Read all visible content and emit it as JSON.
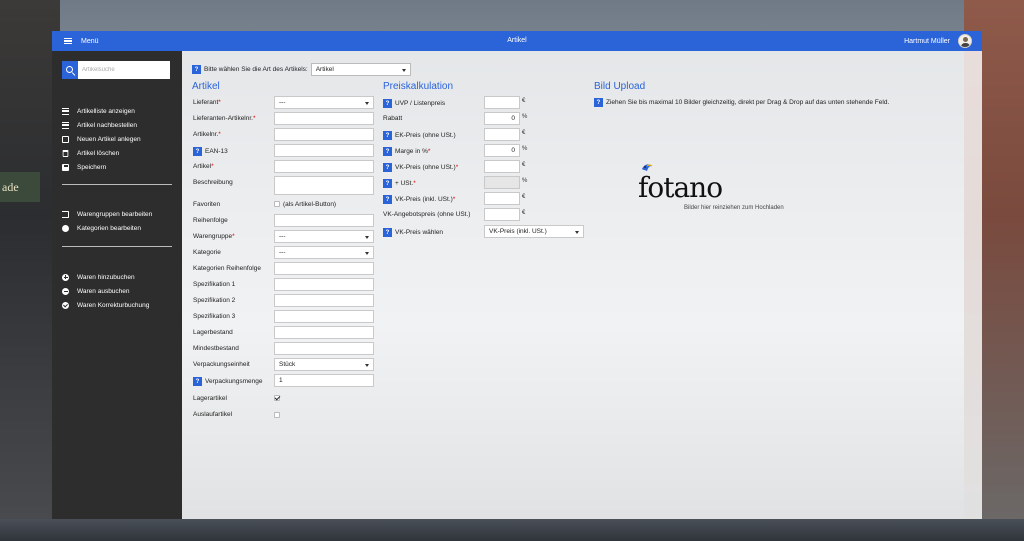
{
  "topbar": {
    "menu_label": "Menü",
    "title": "Artikel",
    "user_name": "Hartmut Müller"
  },
  "sidebar": {
    "search_placeholder": "Artikelsuche",
    "group1": [
      {
        "label": "Artikelliste anzeigen",
        "icon": "list-icon"
      },
      {
        "label": "Artikel nachbestellen",
        "icon": "list-icon"
      },
      {
        "label": "Neuen Artikel anlegen",
        "icon": "edit-icon"
      },
      {
        "label": "Artikel löschen",
        "icon": "trash-icon"
      },
      {
        "label": "Speichern",
        "icon": "save-icon"
      }
    ],
    "group2": [
      {
        "label": "Warengruppen bearbeiten",
        "icon": "sign-in-icon"
      },
      {
        "label": "Kategorien bearbeiten",
        "icon": "arrow-circle-icon"
      }
    ],
    "group3": [
      {
        "label": "Waren hinzubuchen",
        "icon": "plus-circle-icon"
      },
      {
        "label": "Waren ausbuchen",
        "icon": "minus-circle-icon"
      },
      {
        "label": "Waren Korrekturbuchung",
        "icon": "check-circle-icon"
      }
    ]
  },
  "article_type": {
    "label": "Bitte wählen Sie die Art des Artikels:",
    "value": "Artikel"
  },
  "artikel": {
    "title": "Artikel",
    "fields": {
      "lieferant": {
        "label": "Lieferant",
        "value": "---"
      },
      "lieferanten_nr": {
        "label": "Lieferanten-Artikelnr.",
        "value": ""
      },
      "artikelnr": {
        "label": "Artikelnr.",
        "value": ""
      },
      "ean": {
        "label": "EAN-13",
        "value": ""
      },
      "artikel": {
        "label": "Artikel",
        "value": ""
      },
      "beschreibung": {
        "label": "Beschreibung",
        "value": ""
      },
      "favoriten": {
        "label": "Favoriten",
        "checkbox_text": "(als Artikel-Button)"
      },
      "reihenfolge": {
        "label": "Reihenfolge",
        "value": ""
      },
      "warengruppe": {
        "label": "Warengruppe",
        "value": "---"
      },
      "kategorie": {
        "label": "Kategorie",
        "value": "---"
      },
      "kategorien_reihenfolge": {
        "label": "Kategorien Reihenfolge",
        "value": ""
      },
      "spez1": {
        "label": "Spezifikation 1",
        "value": ""
      },
      "spez2": {
        "label": "Spezifikation 2",
        "value": ""
      },
      "spez3": {
        "label": "Spezifikation 3",
        "value": ""
      },
      "lagerbestand": {
        "label": "Lagerbestand",
        "value": ""
      },
      "mindestbestand": {
        "label": "Mindestbestand",
        "value": ""
      },
      "verpackungseinheit": {
        "label": "Verpackungseinheit",
        "value": "Stück"
      },
      "verpackungsmenge": {
        "label": "Verpackungsmenge",
        "value": "1"
      },
      "lagerartikel": {
        "label": "Lagerartikel",
        "checked": true
      },
      "auslaufartikel": {
        "label": "Auslaufartikel",
        "checked": false
      }
    },
    "required_mark": "*"
  },
  "preis": {
    "title": "Preiskalkulation",
    "uvp": {
      "label": "UVP / Listenpreis",
      "value": "",
      "unit": "€"
    },
    "rabatt": {
      "label": "Rabatt",
      "value": "0",
      "unit": "%"
    },
    "ek": {
      "label": "EK-Preis (ohne USt.)",
      "value": "",
      "unit": "€"
    },
    "marge": {
      "label": "Marge in %",
      "value": "0",
      "unit": "%"
    },
    "vk_ohne": {
      "label": "VK-Preis (ohne USt.)",
      "value": "",
      "unit": "€"
    },
    "ust": {
      "label": "+ USt.",
      "value": "",
      "unit": "%"
    },
    "vk_inkl": {
      "label": "VK-Preis (inkl. USt.)",
      "value": "",
      "unit": "€"
    },
    "angebot": {
      "label": "VK-Angebotspreis (ohne USt.)",
      "value": "",
      "unit": "€"
    },
    "vk_waehlen": {
      "label": "VK-Preis wählen",
      "value": "VK-Preis (inkl. USt.)"
    }
  },
  "upload": {
    "title": "Bild Upload",
    "info": "Ziehen Sie bis maximal 10 Bilder gleichzeitig, direkt per Drag & Drop auf das unten stehende Feld.",
    "logo_text": "fotano",
    "drop_hint": "Bilder hier reinziehen zum Hochladen"
  },
  "background": {
    "shop_sign": "ade"
  },
  "colors": {
    "accent": "#2b63d9",
    "sidebar": "#2d2d2d",
    "required": "#dd0000"
  }
}
